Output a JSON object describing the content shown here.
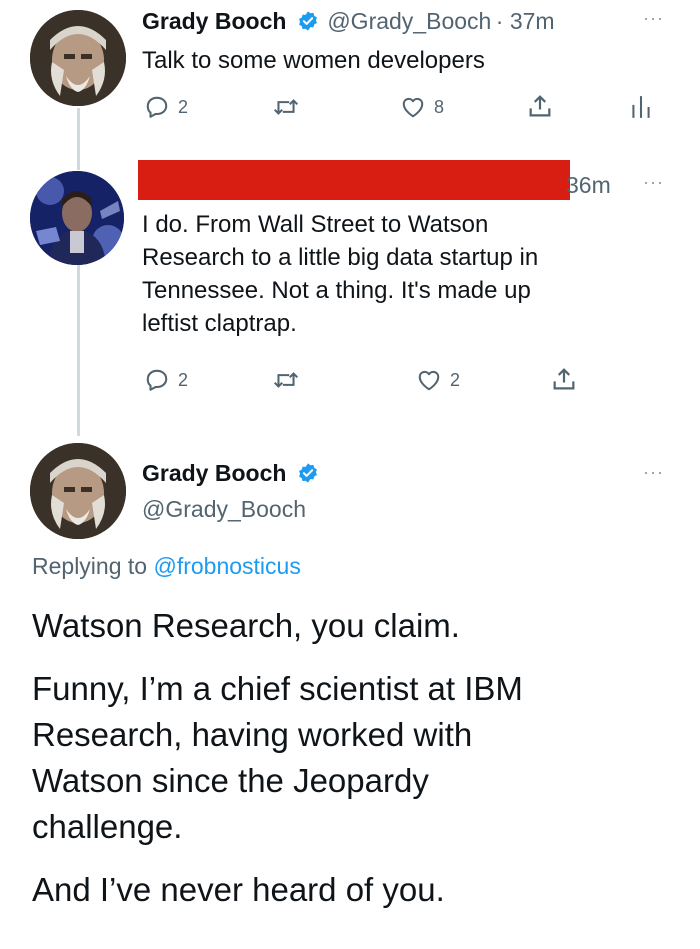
{
  "tweet1": {
    "name": "Grady Booch",
    "handle": "@Grady_Booch",
    "time": "· 37m",
    "text": "Talk to some women developers",
    "reply_count": "2",
    "like_count": "8",
    "more": "···"
  },
  "tweet2": {
    "time": "36m",
    "text_lines": [
      "I do.  From Wall Street to Watson",
      "Research to a little big data startup in",
      "Tennessee.  Not a thing.  It's made up",
      "leftist claptrap."
    ],
    "reply_count": "2",
    "like_count": "2",
    "more": "···"
  },
  "tweet3": {
    "name": "Grady Booch",
    "handle": "@Grady_Booch",
    "more": "···",
    "replying_prefix": "Replying to",
    "replying_to": "@frobnosticus",
    "paragraphs": [
      [
        "Watson Research, you claim."
      ],
      [
        "Funny, I’m a chief scientist at IBM",
        "Research, having worked with",
        "Watson since the Jeopardy",
        "challenge."
      ],
      [
        "And I’ve never heard of you."
      ]
    ]
  },
  "colors": {
    "text": "#0f1419",
    "secondary": "#536471",
    "link": "#1d9bf0",
    "verified": "#1d9bf0",
    "redaction": "#d81e12",
    "thread_line": "#cfd9de"
  },
  "icons": [
    "verified-badge-icon",
    "reply-icon",
    "retweet-icon",
    "like-icon",
    "share-icon",
    "analytics-icon",
    "more-icon"
  ]
}
